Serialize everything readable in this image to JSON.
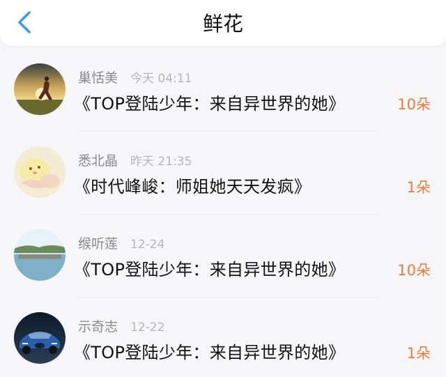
{
  "header": {
    "title": "鲜花",
    "back_icon": "chevron-left-icon"
  },
  "colors": {
    "accent_blue": "#3a9bf2",
    "quantity_orange": "#ee7a3a"
  },
  "gifts": [
    {
      "name": "巢恬美",
      "time": "今天 04:11",
      "book": "《TOP登陆少年：来自异世界的她》",
      "quantity": "10朵",
      "avatar": "sunset-runner"
    },
    {
      "name": "悉北晶",
      "time": "昨天 21:35",
      "book": "《时代峰峻：师姐她天天发疯》",
      "quantity": "1朵",
      "avatar": "cartoon-chick"
    },
    {
      "name": "缑听莲",
      "time": "12-24",
      "book": "《TOP登陆少年：来自异世界的她》",
      "quantity": "10朵",
      "avatar": "lake-bridge"
    },
    {
      "name": "示奇志",
      "time": "12-22",
      "book": "《TOP登陆少年：来自异世界的她》",
      "quantity": "1朵",
      "avatar": "blue-car"
    }
  ]
}
